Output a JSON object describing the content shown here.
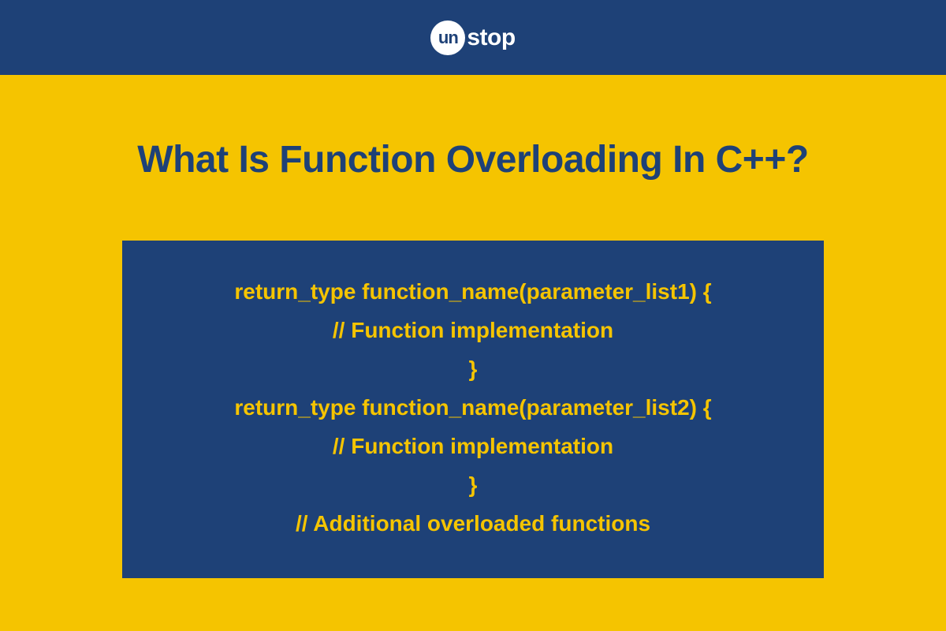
{
  "logo": {
    "circle_text": "un",
    "suffix_text": "stop"
  },
  "title": "What Is Function Overloading In C++?",
  "code_lines": [
    "return_type function_name(parameter_list1) {",
    "// Function implementation",
    "}",
    "return_type function_name(parameter_list2) {",
    "// Function implementation",
    "}",
    "// Additional overloaded functions"
  ]
}
